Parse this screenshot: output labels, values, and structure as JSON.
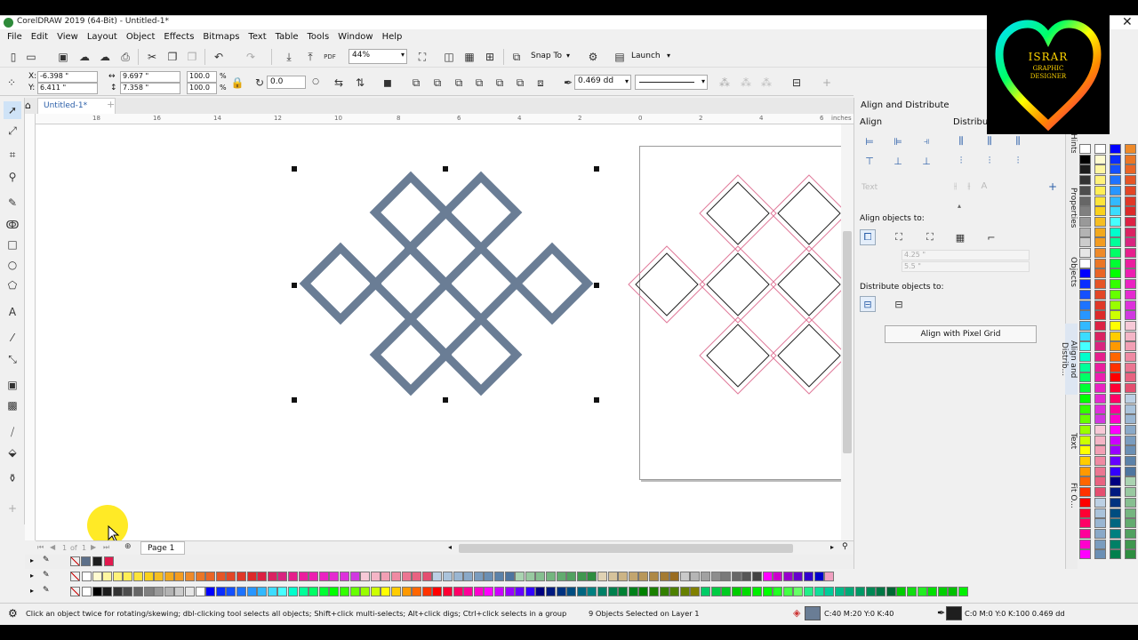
{
  "window": {
    "title": "CorelDRAW 2019 (64-Bit) - Untitled-1*"
  },
  "menu": [
    "File",
    "Edit",
    "View",
    "Layout",
    "Object",
    "Effects",
    "Bitmaps",
    "Text",
    "Table",
    "Tools",
    "Window",
    "Help"
  ],
  "toolbar": {
    "zoom": "44%",
    "snap_to": "Snap To",
    "launch": "Launch"
  },
  "property_bar": {
    "x_label": "X:",
    "x_value": "-6.398 \"",
    "y_label": "Y:",
    "y_value": "6.411 \"",
    "width_value": "9.697 \"",
    "height_value": "7.358 \"",
    "scale_w": "100.0",
    "scale_h": "100.0",
    "percent": "%",
    "angle": "0.0",
    "outline_width": "0.469 dd"
  },
  "document_tab": "Untitled-1*",
  "ruler": {
    "units": "inches",
    "ticks": [
      "18",
      "16",
      "14",
      "12",
      "10",
      "8",
      "6",
      "4",
      "2",
      "0",
      "2",
      "4",
      "6"
    ]
  },
  "page_nav": {
    "current": "1",
    "of": "of",
    "total": "1",
    "page_tab": "Page 1"
  },
  "docker": {
    "title": "Align and Distribute",
    "align_label": "Align",
    "distribute_label": "Distribute",
    "text_label": "Text",
    "align_objects_to": "Align objects to:",
    "x_pos": "4.25 \"",
    "y_pos": "5.5 \"",
    "distribute_objects_to": "Distribute objects to:",
    "pixel_grid_button": "Align with Pixel Grid"
  },
  "side_tabs": [
    "Hints",
    "Properties",
    "Objects",
    "Align and Distrib...",
    "Text",
    "Fit O..."
  ],
  "logo": {
    "line1": "ISRAR",
    "line2": "GRAPHIC",
    "line3": "DESIGNER"
  },
  "status": {
    "hint": "Click an object twice for rotating/skewing; dbl-clicking tool selects all objects; Shift+click multi-selects; Alt+click digs; Ctrl+click selects in a group",
    "selection": "9 Objects Selected on Layer 1",
    "fill": "C:40 M:20 Y:0 K:40",
    "outline": "C:0 M:0 Y:0 K:100  0.469 dd"
  },
  "colors": {
    "fill": "#6a7d95",
    "accent": "#2a5ea8",
    "pink": "#e07a9a",
    "dark": "#1e1e1e"
  },
  "doc_palette": [
    "#5c6f89",
    "#1e1e1e",
    "#e2194e"
  ],
  "palette_row1": [
    "#ffffff",
    "#fffbd0",
    "#fff6a0",
    "#fff27a",
    "#ffee55",
    "#fde43a",
    "#fad11d",
    "#f6be22",
    "#f2a91e",
    "#f39c21",
    "#ee8a2a",
    "#ea7626",
    "#e96526",
    "#e55526",
    "#e24626",
    "#df3828",
    "#dc2a2a",
    "#dc2244",
    "#da2362",
    "#d82580",
    "#e61f8c",
    "#ea1e9e",
    "#ec1eb0",
    "#ea22c2",
    "#e42ad0",
    "#dd31db",
    "#d039e0",
    "#f7c9d7",
    "#f4b5c6",
    "#f29fb4",
    "#ef8aa3",
    "#eb7692",
    "#e86381",
    "#e44f70",
    "#bcd0e4",
    "#aac3db",
    "#9ab6d2",
    "#8aa9c8",
    "#7a9cbe",
    "#6b8fb4",
    "#5c82a9",
    "#4e759f",
    "#aad3b1",
    "#98c9a0",
    "#86bf90",
    "#74b57f",
    "#62ab6f",
    "#51a160",
    "#40974f",
    "#2e8d40",
    "#e0d2b4",
    "#d6c39c",
    "#ccb485",
    "#c2a56f",
    "#b8975a",
    "#ae8946",
    "#a47b33",
    "#9a6d21",
    "#c9c9c9",
    "#b5b5b5",
    "#a1a1a1",
    "#8d8d8d",
    "#7a7a7a",
    "#676767",
    "#555555",
    "#434343",
    "#ff00ff",
    "#cc00cc",
    "#9900cc",
    "#6600cc",
    "#3300cc",
    "#0000cc",
    "#f0a0c0"
  ],
  "palette_row2": [
    "#ffffff",
    "#000000",
    "#1c1c1c",
    "#333333",
    "#4d4d4d",
    "#666666",
    "#808080",
    "#999999",
    "#b3b3b3",
    "#cccccc",
    "#e6e6e6",
    "#ffffff",
    "#0000ff",
    "#0a2dff",
    "#1450ff",
    "#1e73ff",
    "#2896ff",
    "#32b9ff",
    "#3cdcff",
    "#46ffff",
    "#00ffcc",
    "#00ff99",
    "#00ff66",
    "#00ff33",
    "#00ff00",
    "#33ff00",
    "#66ff00",
    "#99ff00",
    "#ccff00",
    "#ffff00",
    "#ffcc00",
    "#ff9900",
    "#ff6600",
    "#ff3300",
    "#ff0000",
    "#ff0033",
    "#ff0066",
    "#ff0099",
    "#ff00cc",
    "#ff00ff",
    "#cc00ff",
    "#9900ff",
    "#6600ff",
    "#3300ff",
    "#000080",
    "#001a80",
    "#003380",
    "#004d80",
    "#006680",
    "#008080",
    "#008066",
    "#00804d",
    "#008033",
    "#00801a",
    "#008000",
    "#1a8000",
    "#338000",
    "#4d8000",
    "#668000",
    "#808000",
    "#00cc66",
    "#00cc44",
    "#00cc22",
    "#00cc00",
    "#00dd00",
    "#00ee00",
    "#00ff00",
    "#22ff22",
    "#44ff44",
    "#66ff66",
    "#22ee88",
    "#11dd99",
    "#00cc99",
    "#00bb88",
    "#00aa77",
    "#009966",
    "#008855",
    "#007744",
    "#006633",
    "#00cc00",
    "#11dd11",
    "#22ee22",
    "#00e000",
    "#00d000",
    "#00c000",
    "#00f000"
  ]
}
